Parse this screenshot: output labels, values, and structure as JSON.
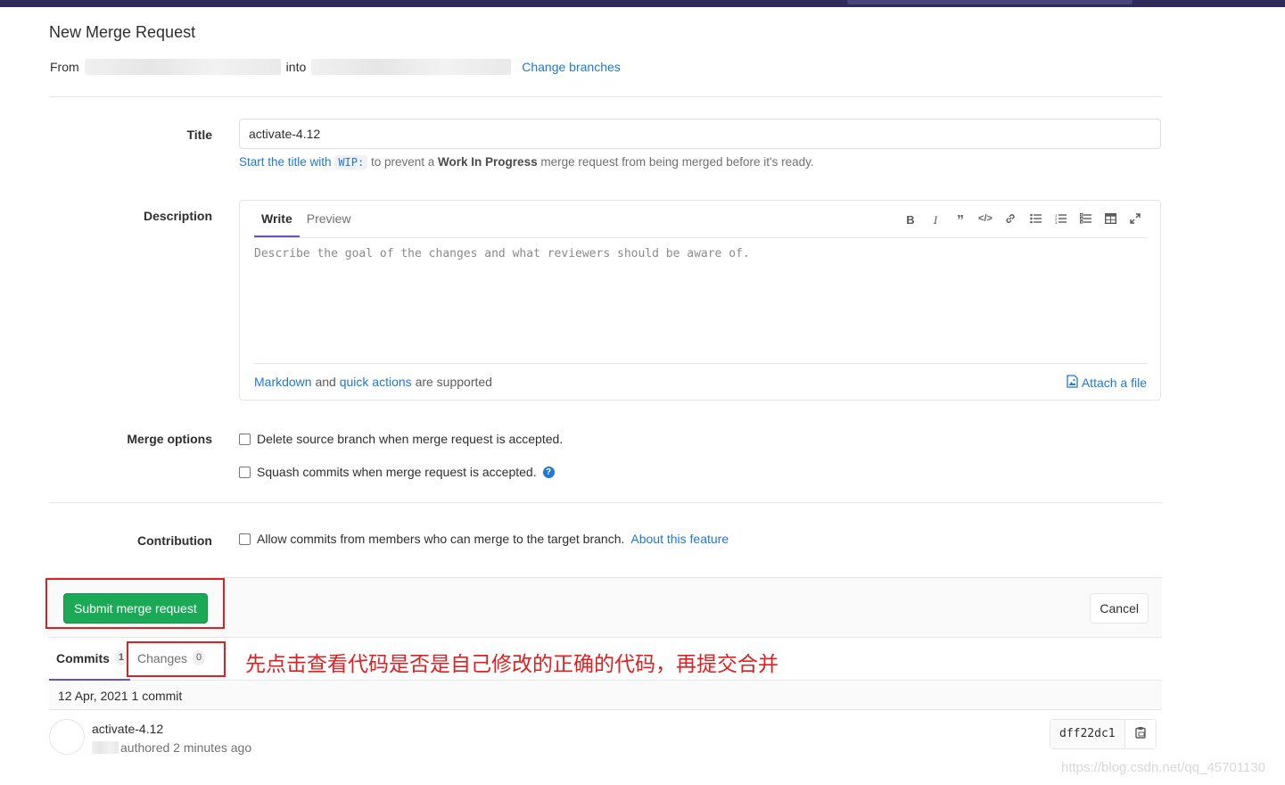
{
  "page_title": "New Merge Request",
  "branch_line": {
    "from_label": "From",
    "into_label": "into",
    "change_branches": "Change branches"
  },
  "title_field": {
    "label": "Title",
    "value": "activate-4.12",
    "hint_prefix": "Start the title with",
    "hint_code": "WIP:",
    "hint_mid": "to prevent a",
    "hint_bold": "Work In Progress",
    "hint_suffix": "merge request from being merged before it's ready."
  },
  "description": {
    "label": "Description",
    "tab_write": "Write",
    "tab_preview": "Preview",
    "placeholder": "Describe the goal of the changes and what reviewers should be aware of.",
    "footer_markdown": "Markdown",
    "footer_and": "and",
    "footer_quick_actions": "quick actions",
    "footer_supported": "are supported",
    "attach": "Attach a file",
    "toolbar_icons": [
      "bold-icon",
      "italic-icon",
      "quote-icon",
      "code-icon",
      "link-icon",
      "bullet-list-icon",
      "numbered-list-icon",
      "task-list-icon",
      "table-icon",
      "fullscreen-icon"
    ]
  },
  "merge_options": {
    "label": "Merge options",
    "delete_source": "Delete source branch when merge request is accepted.",
    "squash": "Squash commits when merge request is accepted."
  },
  "contribution": {
    "label": "Contribution",
    "allow_commits": "Allow commits from members who can merge to the target branch.",
    "about": "About this feature"
  },
  "actions": {
    "submit": "Submit merge request",
    "cancel": "Cancel"
  },
  "tabs": {
    "commits_label": "Commits",
    "commits_count": "1",
    "changes_label": "Changes",
    "changes_count": "0"
  },
  "annotation": "先点击查看代码是否是自己修改的正确的代码，再提交合并",
  "commit_list": {
    "day_header": "12 Apr, 2021 1 commit",
    "commit_title": "activate-4.12",
    "commit_meta": "authored 2 minutes ago",
    "sha": "dff22dc1"
  },
  "watermark": "https://blog.csdn.net/qq_45701130",
  "colors": {
    "accent": "#1f78d1",
    "submit_green": "#1aaa55",
    "annotation_red": "#e02020",
    "tab_underline": "#6b4fbb"
  }
}
